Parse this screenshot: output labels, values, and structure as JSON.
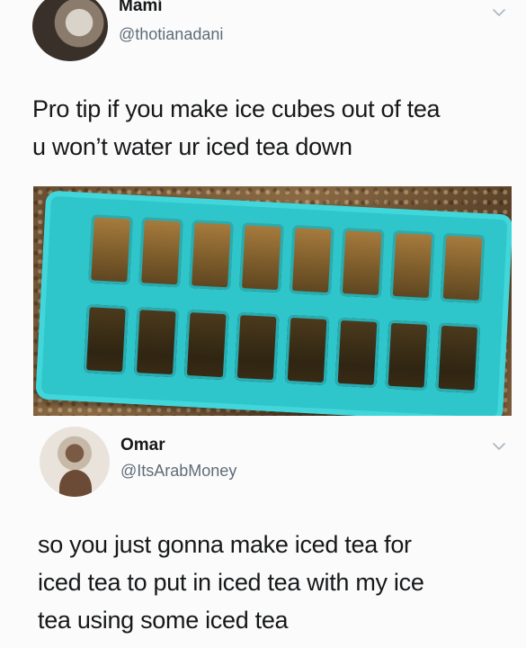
{
  "tweets": [
    {
      "author_name": "Mamí",
      "author_handle": "@thotianadani",
      "text_lines": [
        "Pro tip if you make ice cubes out of tea",
        "u won’t water ur iced tea down"
      ],
      "has_photo": true
    },
    {
      "author_name": "Omar",
      "author_handle": "@ItsArabMoney",
      "text_lines": [
        "so you just gonna make iced tea for",
        "iced tea to put in iced tea with my ice",
        "tea using some iced tea"
      ],
      "has_photo": false
    }
  ],
  "icons": {
    "menu": "chevron-down-icon"
  },
  "colors": {
    "handle": "#5f6c78",
    "tray": "#2fc6cb"
  }
}
